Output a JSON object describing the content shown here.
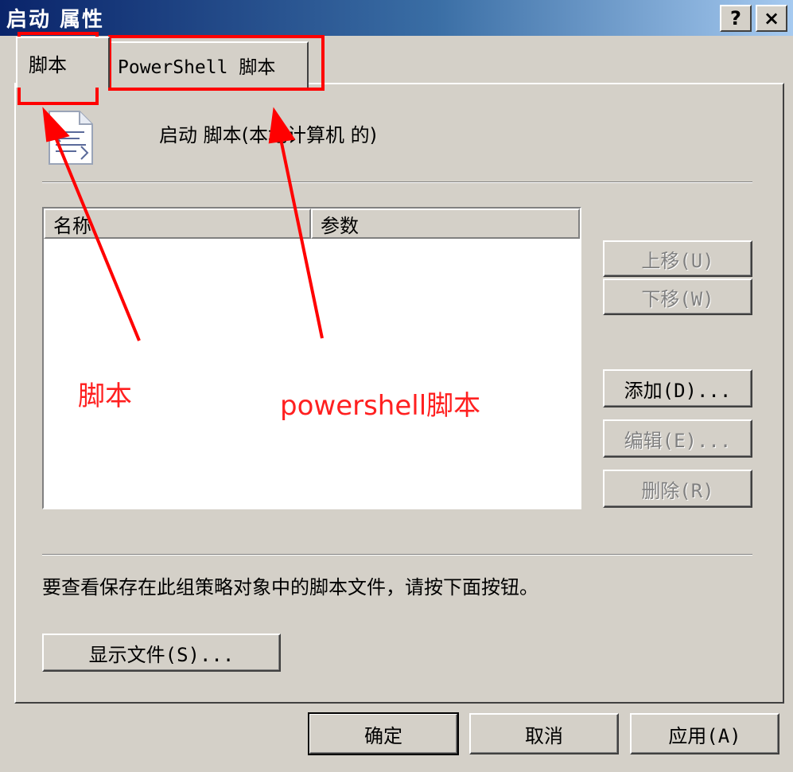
{
  "window": {
    "title": "启动 属性",
    "help_btn": "?",
    "close_btn": "×"
  },
  "tabs": [
    {
      "label": "脚本",
      "active": true
    },
    {
      "label": "PowerShell 脚本",
      "active": false
    }
  ],
  "header": {
    "icon": "script-document-icon",
    "text": "启动 脚本(本地计算机 的)"
  },
  "list": {
    "columns": [
      "名称",
      "参数"
    ],
    "rows": []
  },
  "side_buttons": {
    "up": "上移(U)",
    "down": "下移(W)",
    "add": "添加(D)...",
    "edit": "编辑(E)...",
    "remove": "删除(R)"
  },
  "footer_note": "要查看保存在此组策略对象中的脚本文件，请按下面按钮。",
  "show_files_btn": "显示文件(S)...",
  "dialog_buttons": {
    "ok": "确定",
    "cancel": "取消",
    "apply": "应用(A)"
  },
  "annotations": {
    "label_script": "脚本",
    "label_powershell": "powershell脚本",
    "color": "#ff0000"
  }
}
